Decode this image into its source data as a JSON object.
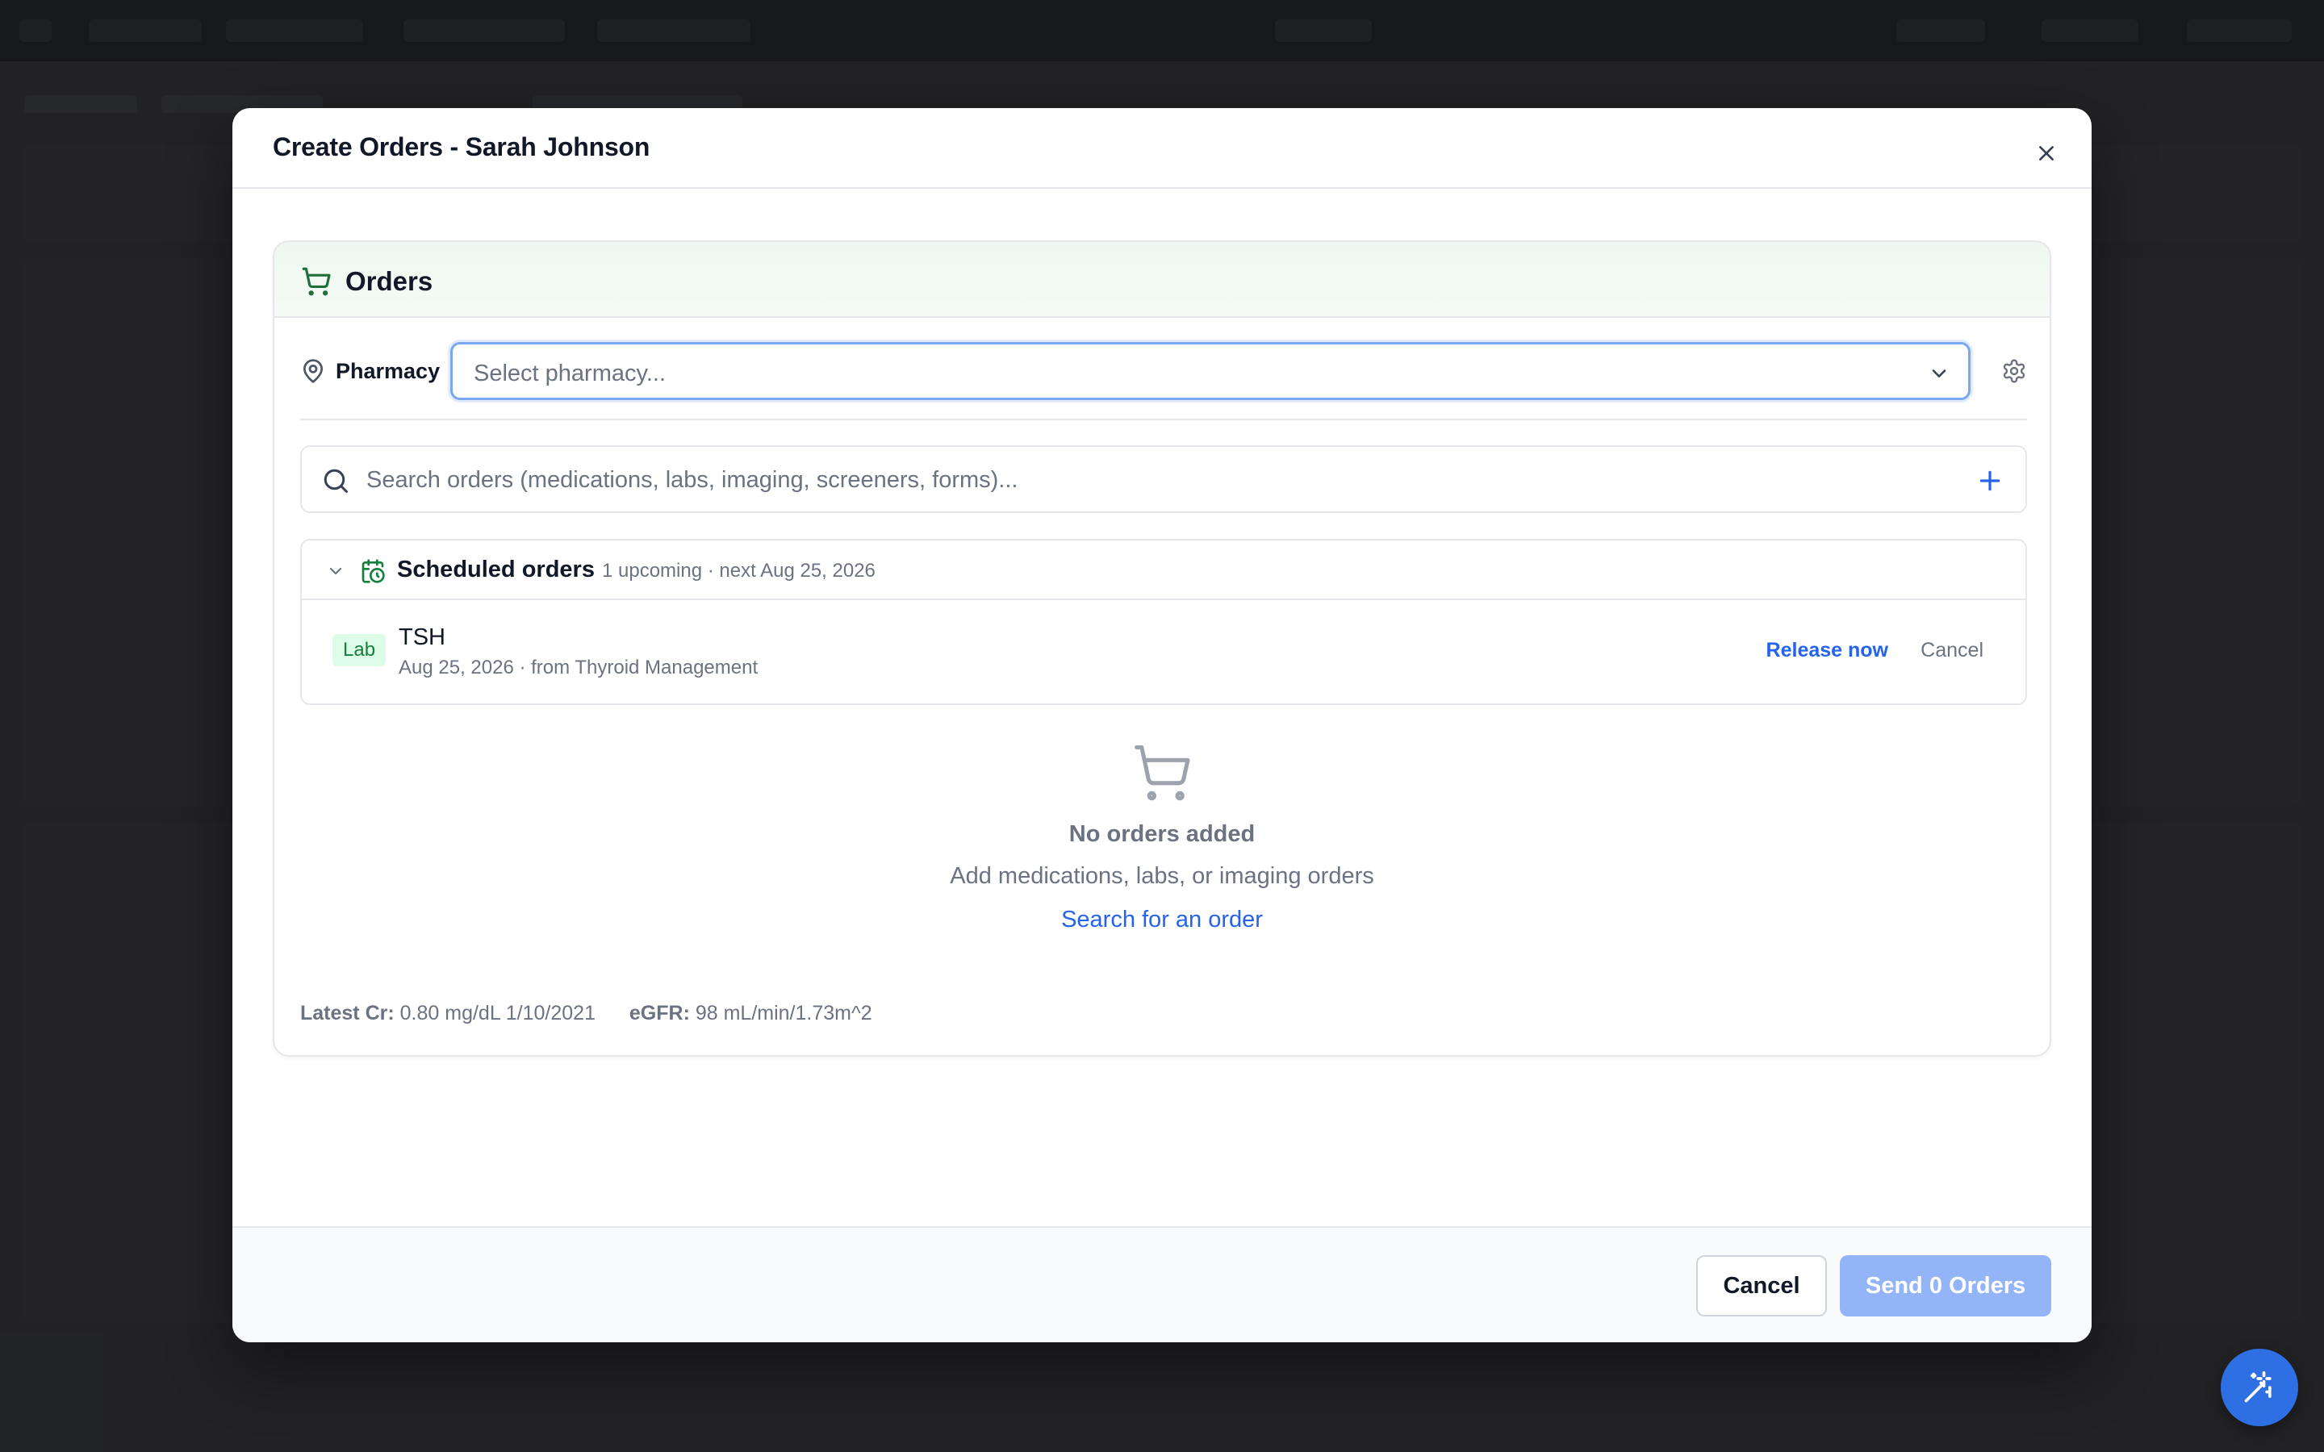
{
  "modal": {
    "title": "Create Orders - Sarah Johnson"
  },
  "orders": {
    "section_title": "Orders",
    "pharmacy_label": "Pharmacy",
    "pharmacy_placeholder": "Select pharmacy...",
    "search_placeholder": "Search orders (medications, labs, imaging, screeners, forms)..."
  },
  "scheduled": {
    "title": "Scheduled orders",
    "meta": "1 upcoming · next Aug 25, 2026",
    "items": [
      {
        "badge": "Lab",
        "name": "TSH",
        "sub": "Aug 25, 2026 · from Thyroid Management",
        "release_label": "Release now",
        "cancel_label": "Cancel"
      }
    ]
  },
  "empty_state": {
    "title": "No orders added",
    "subtitle": "Add medications, labs, or imaging orders",
    "link": "Search for an order"
  },
  "labs": {
    "cr_label": "Latest Cr:",
    "cr_value": "0.80 mg/dL",
    "cr_date": "1/10/2021",
    "egfr_label": "eGFR:",
    "egfr_value": "98 mL/min/1.73m^2"
  },
  "footer": {
    "cancel_label": "Cancel",
    "send_label": "Send 0 Orders"
  },
  "colors": {
    "accent": "#2563eb",
    "send_disabled": "#93b4f6",
    "lab_badge_bg": "#dcfce7",
    "lab_badge_text": "#15803d",
    "fab": "#2f6fe4"
  },
  "icons": [
    "close-icon",
    "cart-icon",
    "map-pin-icon",
    "chevron-down-icon",
    "gear-icon",
    "search-icon",
    "plus-icon",
    "calendar-clock-icon",
    "magic-wand-icon"
  ]
}
